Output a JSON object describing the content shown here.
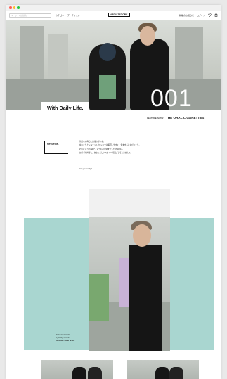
{
  "browser": {
    "dots": [
      "#ff5f57",
      "#febc2e",
      "#28c840"
    ]
  },
  "header": {
    "search_placeholder": "キーワードから探す",
    "nav": [
      "カテゴリ",
      "アーティスト"
    ],
    "logo": "ARTISTSTORE",
    "right_link": "新着のお知らせ",
    "login": "ログイン"
  },
  "hero": {
    "tagline": "With Daily Life.",
    "number": "001",
    "feature_label": "FEATURE ARTIST",
    "artist": "THE ORAL CIGARETTES"
  },
  "situation": {
    "label": "SITUATION.",
    "lines": [
      "何気ない毎日に日常の彩りを。",
      "ゆったりとシルエットのTシャツは着回しやすく、何をするにもぴったり。",
      "お気に入りの1着で、いつもの日常を少しだけ特別に。",
      "お家でも外でも、あなたらしいスタイルで過ごしてみませんか。"
    ],
    "ready": "Are you ready?"
  },
  "credits": [
    "Model: Yuri Yoshida",
    "Stylist: Ryo Yamada",
    "Hair&Make: Misaki Tanaka"
  ]
}
